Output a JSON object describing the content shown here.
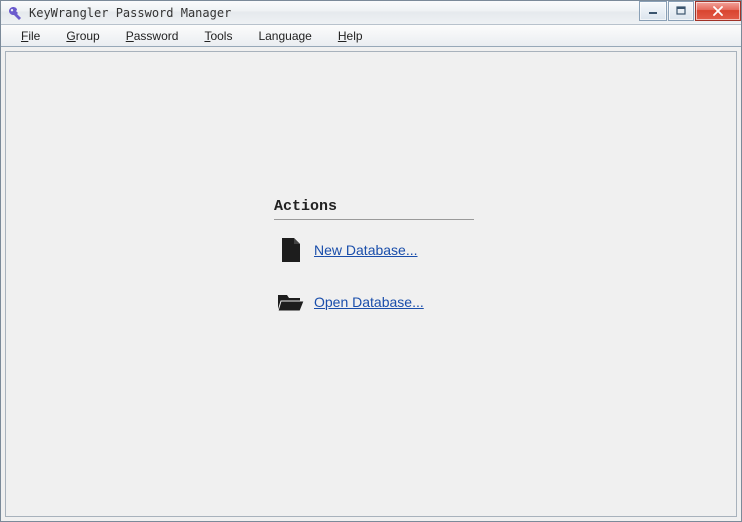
{
  "window": {
    "title": "KeyWrangler Password Manager"
  },
  "menu": {
    "items": [
      {
        "label": "File",
        "mnemonicIndex": 0
      },
      {
        "label": "Group",
        "mnemonicIndex": 0
      },
      {
        "label": "Password",
        "mnemonicIndex": 0
      },
      {
        "label": "Tools",
        "mnemonicIndex": 0
      },
      {
        "label": "Language",
        "mnemonicIndex": -1
      },
      {
        "label": "Help",
        "mnemonicIndex": 0
      }
    ]
  },
  "actions": {
    "header": "Actions",
    "items": [
      {
        "label": "New Database...",
        "mnemonicIndex": 0,
        "icon": "file-icon"
      },
      {
        "label": "Open Database...",
        "mnemonicIndex": 0,
        "icon": "folder-icon"
      }
    ]
  }
}
